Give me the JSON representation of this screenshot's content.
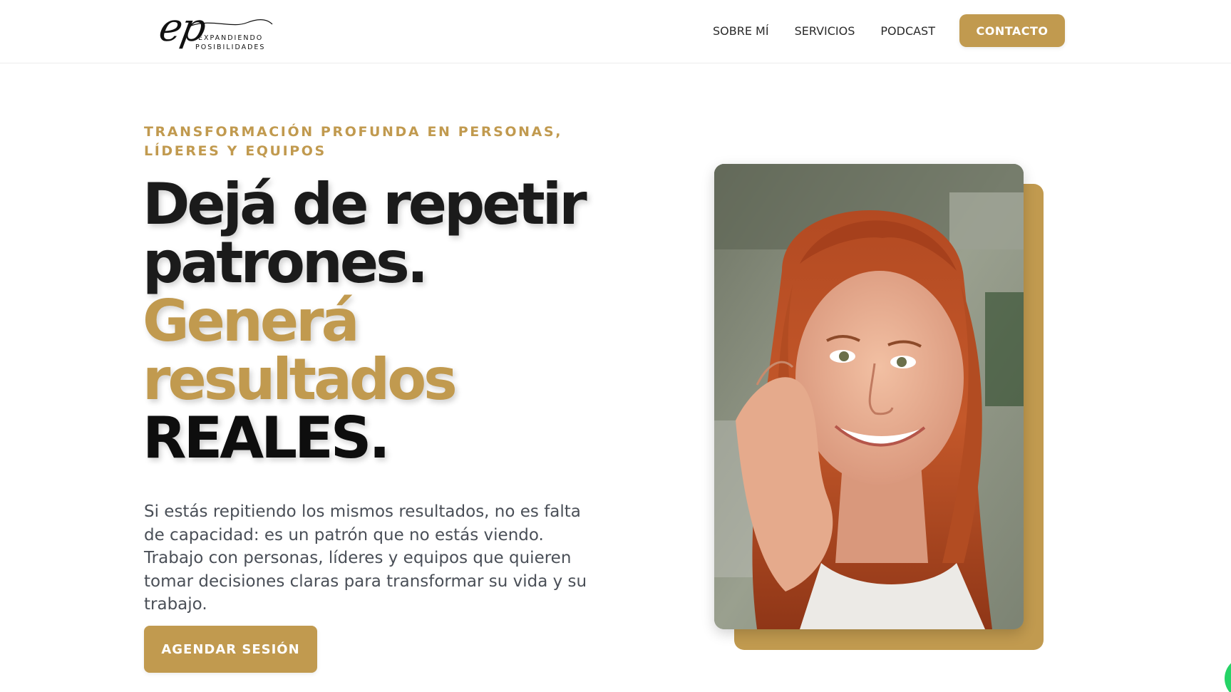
{
  "brand": {
    "logo_mark": "ep",
    "logo_line1": "EXPANDIENDO",
    "logo_line2": "POSIBILIDADES"
  },
  "nav": {
    "items": [
      {
        "label": "SOBRE MÍ"
      },
      {
        "label": "SERVICIOS"
      },
      {
        "label": "PODCAST"
      }
    ],
    "cta_label": "CONTACTO"
  },
  "hero": {
    "eyebrow": "TRANSFORMACIÓN PROFUNDA EN PERSONAS, LÍDERES Y EQUIPOS",
    "headline_line1": "Dejá de repetir",
    "headline_line2": "patrones.",
    "headline_line3": "Generá",
    "headline_line4": "resultados",
    "headline_line5": "REALES.",
    "lead": "Si estás repitiendo los mismos resultados, no es falta de capacidad: es un patrón que no estás viendo. Trabajo con personas, líderes y equipos que quieren tomar decisiones claras para transformar su vida y su trabajo.",
    "cta_label": "AGENDAR SESIÓN"
  },
  "colors": {
    "accent": "#c19a4f",
    "text_dark": "#1b1b1b",
    "text_body": "#4a4f57",
    "whatsapp": "#25d366"
  },
  "icons": {
    "whatsapp": "whatsapp-icon"
  }
}
